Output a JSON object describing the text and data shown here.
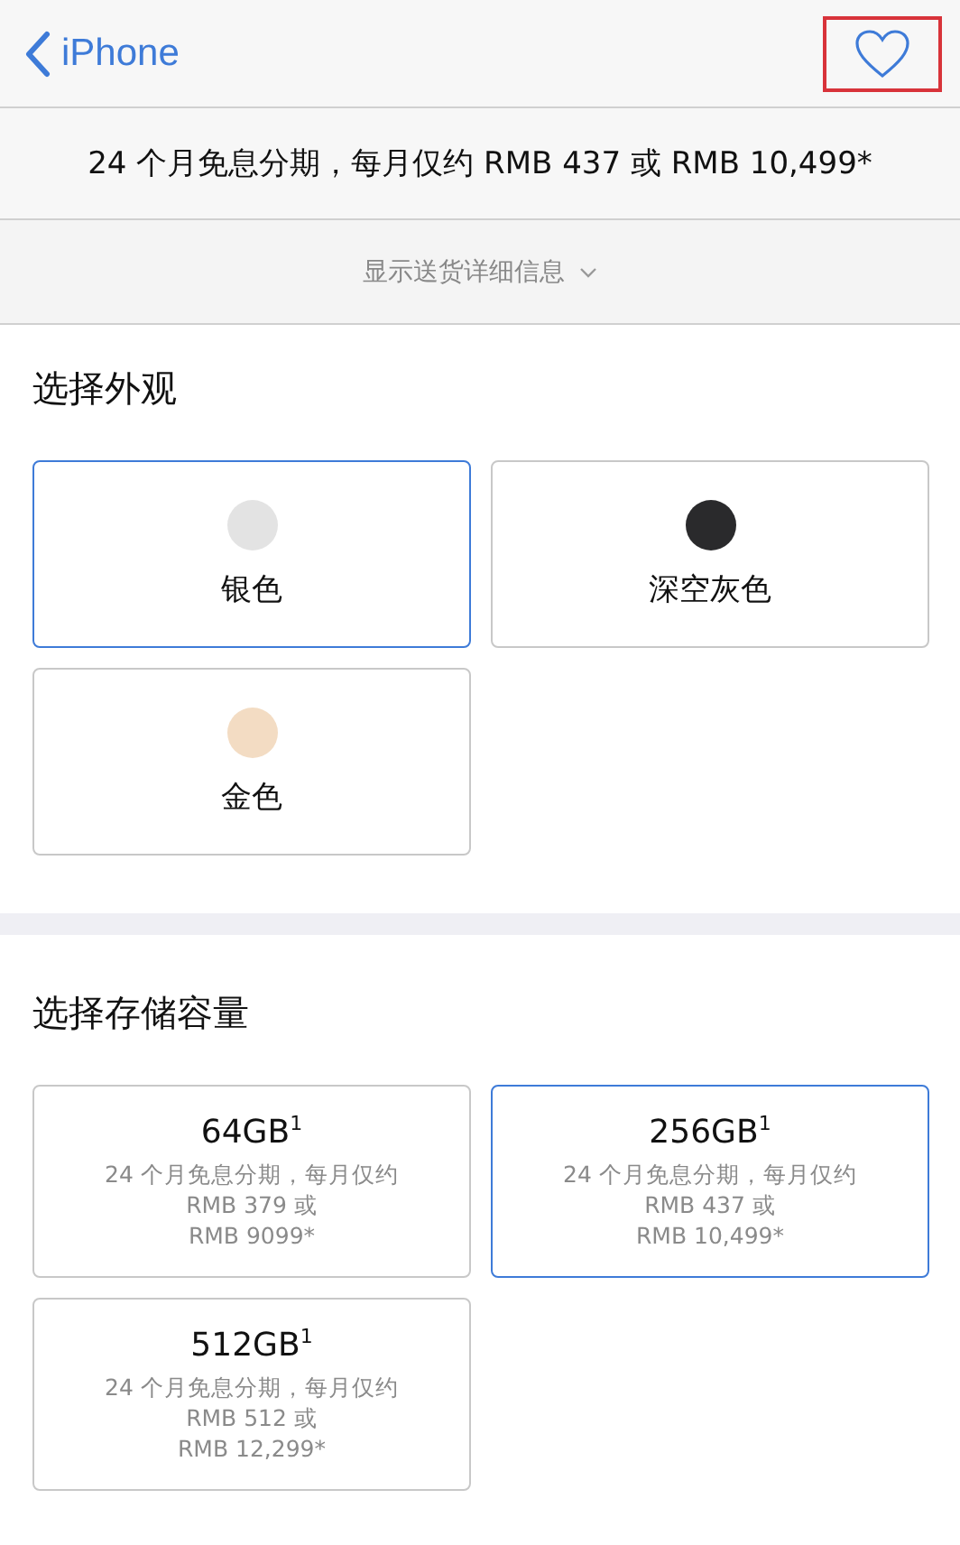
{
  "nav": {
    "back_label": "iPhone",
    "favorite": {
      "highlighted": true
    }
  },
  "promo": "24 个月免息分期，每月仅约 RMB 437 或 RMB 10,499*",
  "shipping_toggle": {
    "label": "显示送货详细信息",
    "expanded": false
  },
  "finish": {
    "title": "选择外观",
    "options": [
      {
        "label": "银色",
        "color": "#e3e3e3",
        "selected": true
      },
      {
        "label": "深空灰色",
        "color": "#2a2a2c",
        "selected": false
      },
      {
        "label": "金色",
        "color": "#f3dcc3",
        "selected": false
      }
    ]
  },
  "storage": {
    "title": "选择存储容量",
    "options": [
      {
        "label": "64GB$^{1}$",
        "lines": [
          "24 个月免息分期，每月仅约",
          "RMB 379 或",
          "RMB 9099*"
        ],
        "selected": false
      },
      {
        "label": "256GB$^{1}$",
        "lines": [
          "24 个月免息分期，每月仅约",
          "RMB 437 或",
          "RMB 10,499*"
        ],
        "selected": true
      },
      {
        "label": "512GB$^{1}$",
        "lines": [
          "24 个月免息分期，每月仅约",
          "RMB 512 或",
          "RMB 12,299*"
        ],
        "selected": false
      }
    ]
  }
}
